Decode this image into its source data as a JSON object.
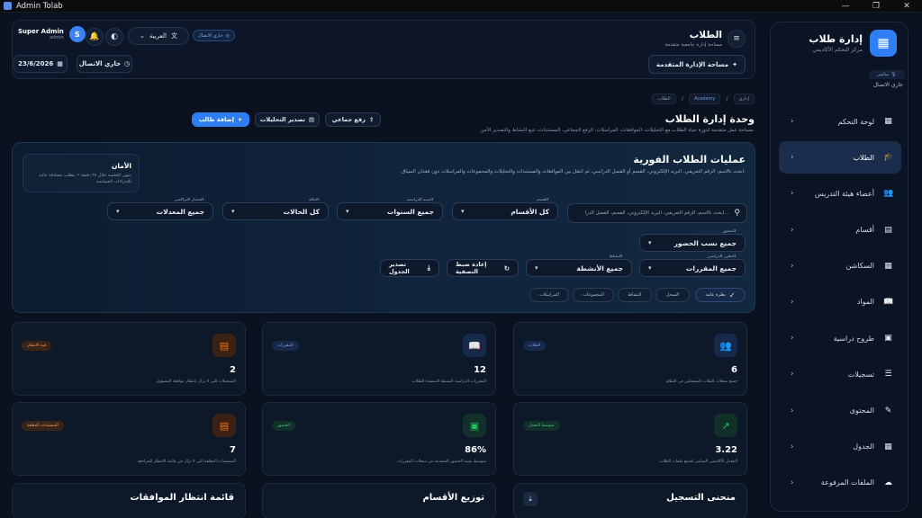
{
  "window": {
    "title": "Admin Tolab",
    "minimize": "—",
    "maximize": "❐",
    "close": "✕"
  },
  "brand": {
    "title": "إدارة طلاب",
    "subtitle": "مركز التحكم الأكاديمي",
    "live_chip": "مباشر",
    "live_text": "جاري الاتصال"
  },
  "nav": [
    {
      "label": "لوحة التحكم",
      "icon": "▦",
      "name": "dashboard"
    },
    {
      "label": "الطلاب",
      "icon": "🎓",
      "name": "students",
      "active": true
    },
    {
      "label": "أعضاء هيئة التدريس",
      "icon": "👥",
      "name": "faculty"
    },
    {
      "label": "أقسام",
      "icon": "▤",
      "name": "departments"
    },
    {
      "label": "السكاشن",
      "icon": "▦",
      "name": "sections"
    },
    {
      "label": "المواد",
      "icon": "📖",
      "name": "subjects"
    },
    {
      "label": "طروح دراسية",
      "icon": "▣",
      "name": "offerings"
    },
    {
      "label": "تسجيلات",
      "icon": "☰",
      "name": "enrollments"
    },
    {
      "label": "المحتوى",
      "icon": "✎",
      "name": "content"
    },
    {
      "label": "الجدول",
      "icon": "▦",
      "name": "schedule"
    },
    {
      "label": "الملفات المرفوعة",
      "icon": "☁",
      "name": "uploads"
    }
  ],
  "header": {
    "title": "الطلاب",
    "subtitle": "مساحة إدارة جامعية متقدمة",
    "menu_icon": "≡",
    "user_name": "Super Admin",
    "user_role": "admin",
    "avatar_letter": "S",
    "language": "العربية",
    "lang_chevron": "⌄",
    "lang_icon": "文",
    "bell_icon": "🔔",
    "theme_icon": "◐",
    "connection_badge": "جاري الاتصال",
    "connection_icon": "◎",
    "adv_button": "مساحة الإدارة المتقدمة",
    "adv_icon": "✦",
    "status_button": "جاري الاتصال",
    "status_icon": "◷",
    "date": "23/6/2026",
    "date_icon": "▦"
  },
  "breadcrumbs": [
    "إداري",
    "Academy",
    "الطلاب"
  ],
  "page": {
    "title": "وحدة إدارة الطلاب",
    "subtitle": "مساحة عمل متقدمة لدورة حياة الطلاب مع التحليلات، الموافقات، المراسلات، الرفع الجماعي، المستندات، تتبع النشاط والتصدير الآمن.",
    "add_student": "إضافة طالب",
    "add_icon": "+",
    "export_analytics": "تصدير التحليلات",
    "export_icon": "▤",
    "bulk_upload": "رفع جماعي",
    "upload_icon": "⇪"
  },
  "ops": {
    "title": "عمليات الطلاب الفورية",
    "subtitle": "ابحث بالاسم، الرقم التعريفي، البريد الإلكتروني، القسم أو الفصل الدراسي، ثم انتقل بين الموافقات والمستندات والتحليلات والمجموعات والمراسلات دون فقدان السياق.",
    "security_title": "الأمان",
    "security_text": "تنتهي الجلسة خلال ٢٨ دقيقة • يتطلب مصادقة ثنائية للإجراءات الحساسة",
    "search_placeholder": "ابحث بالاسم، الرقم التعريفي، البريد الإلكتروني، القسم، الفصل الدرا...",
    "search_icon": "⚲",
    "filters": {
      "departments": {
        "cap": "القسم",
        "value": "كل الأقسام"
      },
      "years": {
        "cap": "السنة الدراسية",
        "value": "جميع السنوات"
      },
      "status": {
        "cap": "الحالة",
        "value": "كل الحالات"
      },
      "gpa": {
        "cap": "المعدل التراكمي",
        "value": "جميع المعدلات"
      },
      "attendance": {
        "cap": "الحضور",
        "value": "جميع نسب الحضور"
      },
      "courses": {
        "cap": "المقرر الدراسي",
        "value": "جميع المقررات"
      },
      "activities": {
        "cap": "النشاط",
        "value": "جميع الأنشطة"
      }
    },
    "arrow": "▾",
    "reset": "إعادة ضبط التصفية",
    "reset_icon": "↻",
    "export_table": "تصدير الجدول",
    "export_table_icon": "⤓",
    "tabs": [
      "نظرة عامة",
      "السجل",
      "النشاط",
      "المجموعات",
      "المراسلات"
    ],
    "check_icon": "✓"
  },
  "stats": [
    {
      "value": "6",
      "desc": "جميع سجلات الطلاب المسجلين في النظام",
      "tag": "الطلاب",
      "icon": "👥",
      "color": "#3b82f6",
      "bg": "#15294a",
      "tagbg": "#16294a",
      "tagfg": "#7fa7e6"
    },
    {
      "value": "12",
      "desc": "المقررات الدراسية النشطة المسندة للطلاب",
      "tag": "المقررات",
      "icon": "📖",
      "color": "#5b8def",
      "bg": "#17294a",
      "tagbg": "#17284a",
      "tagfg": "#86a6dd"
    },
    {
      "value": "2",
      "desc": "التسجيلات التي لا تزال بانتظار موافقة المسؤول",
      "tag": "قيد الانتظار",
      "icon": "▤",
      "color": "#f97316",
      "bg": "#3a2114",
      "tagbg": "#3a2418",
      "tagfg": "#f2a066"
    },
    {
      "value": "3.22",
      "desc": "المعدل الأكاديمي المباشر لجميع ملفات الطلاب",
      "tag": "متوسط المعدل",
      "icon": "↗",
      "color": "#22c55e",
      "bg": "#12302a",
      "tagbg": "#12302a",
      "tagfg": "#4ecb87"
    },
    {
      "value": "86%",
      "desc": "متوسط نسبة الحضور المتقدمة من سجلات المقررات",
      "tag": "الحضور",
      "icon": "▣",
      "color": "#22c55e",
      "bg": "#12302a",
      "tagbg": "#12302a",
      "tagfg": "#4ecb87"
    },
    {
      "value": "7",
      "desc": "المستندات المعلقة التي لا تزال في قائمة الانتظار للمراجعة",
      "tag": "المستندات المعلقة",
      "icon": "▤",
      "color": "#f97316",
      "bg": "#3a2114",
      "tagbg": "#3a2418",
      "tagfg": "#f2a066"
    }
  ],
  "bottom": {
    "enrollment_curve": "منحنى التسجيل",
    "download_icon": "⤓",
    "dept_distribution": "توزيع الأقسام",
    "approvals_queue": "قائمة انتظار الموافقات"
  }
}
